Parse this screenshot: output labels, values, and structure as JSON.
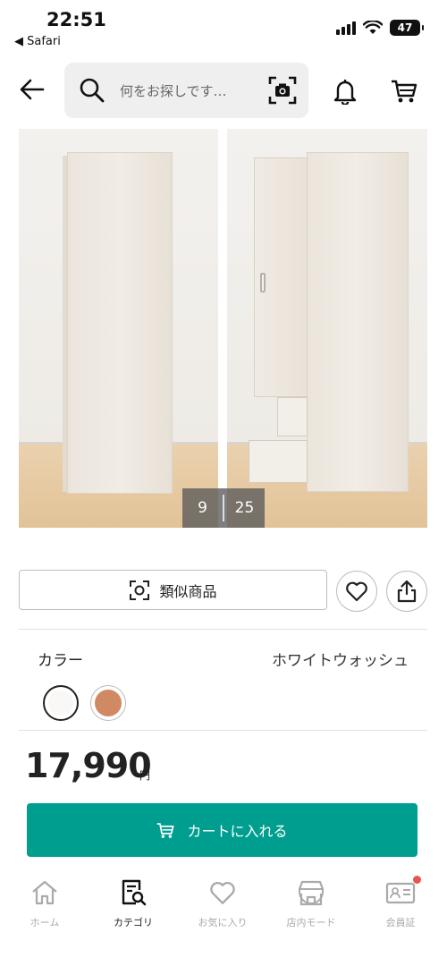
{
  "status_bar": {
    "time": "22:51",
    "back_app": "◀ Safari",
    "battery": "47"
  },
  "header": {
    "search_placeholder": "何をお探しです…",
    "icons": [
      "back-arrow-icon",
      "search-icon",
      "camera-scan-icon",
      "bell-icon",
      "cart-icon"
    ]
  },
  "gallery": {
    "current": "9",
    "total": "25"
  },
  "actions": {
    "similar_label": "類似商品",
    "icons": [
      "scan-icon",
      "heart-icon",
      "share-icon"
    ]
  },
  "color": {
    "label": "カラー",
    "selected": "ホワイトウォッシュ",
    "swatches": [
      {
        "name": "white-wash",
        "color": "#faf8f6",
        "selected": true
      },
      {
        "name": "brown",
        "color": "#cf8a63",
        "selected": false
      }
    ]
  },
  "price": {
    "amount": "17,990",
    "unit": "円"
  },
  "cart_button": {
    "label": "カートに入れる",
    "color": "#009e8f"
  },
  "tabbar": {
    "items": [
      {
        "label": "ホーム",
        "icon": "home-icon",
        "active": false
      },
      {
        "label": "カテゴリ",
        "icon": "category-search-icon",
        "active": true
      },
      {
        "label": "お気に入り",
        "icon": "heart-icon",
        "active": false
      },
      {
        "label": "店内モード",
        "icon": "store-icon",
        "active": false
      },
      {
        "label": "会員証",
        "icon": "member-card-icon",
        "active": false
      }
    ]
  }
}
